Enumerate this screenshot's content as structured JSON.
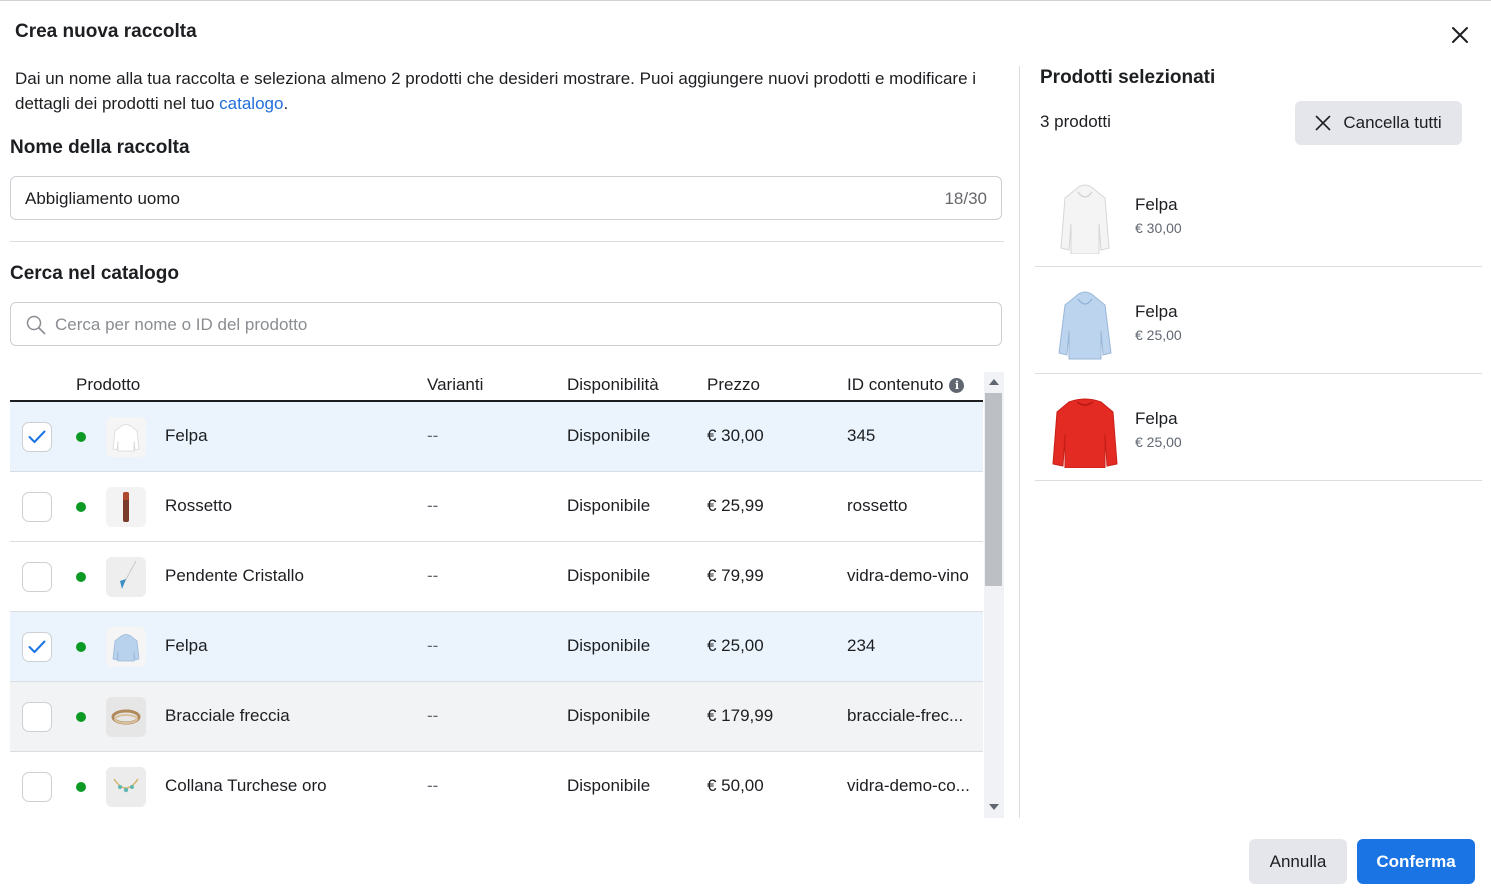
{
  "dialog": {
    "title": "Crea nuova raccolta",
    "description": "Dai un nome alla tua raccolta e seleziona almeno 2 prodotti che desideri mostrare. Puoi aggiungere nuovi prodotti e modificare i dettagli dei prodotti nel tuo ",
    "description_link": "catalogo",
    "description_end": "."
  },
  "collection_name": {
    "label": "Nome della raccolta",
    "value": "Abbigliamento uomo",
    "counter": "18/30"
  },
  "catalog_search": {
    "label": "Cerca nel catalogo",
    "placeholder": "Cerca per nome o ID del prodotto"
  },
  "table": {
    "headers": {
      "product": "Prodotto",
      "variants": "Varianti",
      "availability": "Disponibilità",
      "price": "Prezzo",
      "content_id": "ID contenuto"
    },
    "rows": [
      {
        "checked": true,
        "thumb": "hoodie-white",
        "name": "Felpa",
        "variants": "--",
        "availability": "Disponibile",
        "price": "€ 30,00",
        "content_id": "345"
      },
      {
        "checked": false,
        "thumb": "lipstick",
        "name": "Rossetto",
        "variants": "--",
        "availability": "Disponibile",
        "price": "€ 25,99",
        "content_id": "rossetto"
      },
      {
        "checked": false,
        "thumb": "crystal-pendant",
        "name": "Pendente Cristallo",
        "variants": "--",
        "availability": "Disponibile",
        "price": "€ 79,99",
        "content_id": "vidra-demo-vino"
      },
      {
        "checked": true,
        "thumb": "hoodie-lightblue",
        "name": "Felpa",
        "variants": "--",
        "availability": "Disponibile",
        "price": "€ 25,00",
        "content_id": "234"
      },
      {
        "checked": false,
        "thumb": "arrow-bracelet",
        "name": "Bracciale freccia",
        "variants": "--",
        "availability": "Disponibile",
        "price": "€ 179,99",
        "content_id": "bracciale-frec..."
      },
      {
        "checked": false,
        "thumb": "turquoise-necklace",
        "name": "Collana Turchese oro",
        "variants": "--",
        "availability": "Disponibile",
        "price": "€ 50,00",
        "content_id": "vidra-demo-co..."
      }
    ]
  },
  "selected_panel": {
    "title": "Prodotti selezionati",
    "count": "3 prodotti",
    "clear_all": "Cancella tutti",
    "items": [
      {
        "thumb": "hoodie-white",
        "name": "Felpa",
        "price": "€ 30,00"
      },
      {
        "thumb": "hoodie-lightblue",
        "name": "Felpa",
        "price": "€ 25,00"
      },
      {
        "thumb": "sweatshirt-red",
        "name": "Felpa",
        "price": "€ 25,00"
      }
    ]
  },
  "footer": {
    "cancel": "Annulla",
    "confirm": "Conferma"
  },
  "colors": {
    "primary": "#1b74e4",
    "link": "#216fdb",
    "selected_row": "#ebf4fd",
    "available_dot": "#0d9a24",
    "secondary_button": "#e4e6eb"
  }
}
